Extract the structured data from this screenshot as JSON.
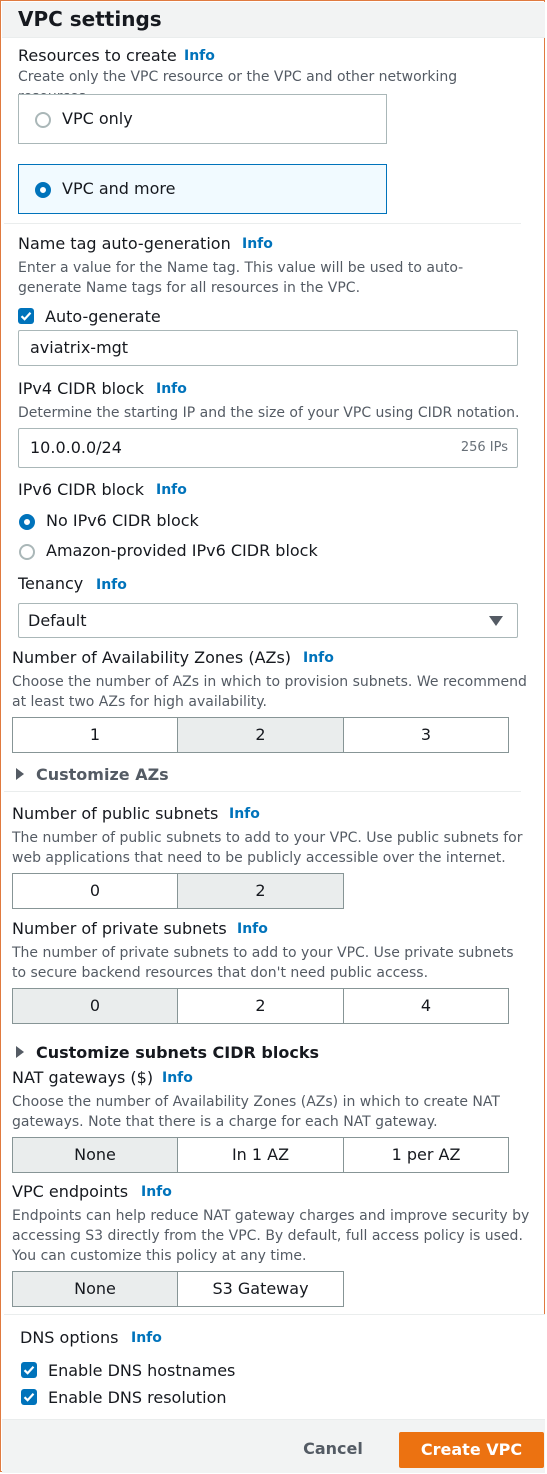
{
  "header": {
    "title": "VPC settings"
  },
  "resources": {
    "label": "Resources to create",
    "info": "Info",
    "description": "Create only the VPC resource or the VPC and other networking resources.",
    "options": [
      "VPC only",
      "VPC and more"
    ],
    "selected": "VPC and more"
  },
  "name_tag": {
    "label": "Name tag auto-generation",
    "info": "Info",
    "description": "Enter a value for the Name tag. This value will be used to auto-generate Name tags for all resources in the VPC.",
    "checkbox_label": "Auto-generate",
    "checked": true,
    "value": "aviatrix-mgt"
  },
  "ipv4": {
    "label": "IPv4 CIDR block",
    "info": "Info",
    "description": "Determine the starting IP and the size of your VPC using CIDR notation.",
    "value": "10.0.0.0/24",
    "suffix": "256 IPs"
  },
  "ipv6": {
    "label": "IPv6 CIDR block",
    "info": "Info",
    "options": [
      "No IPv6 CIDR block",
      "Amazon-provided IPv6 CIDR block"
    ],
    "selected": "No IPv6 CIDR block"
  },
  "tenancy": {
    "label": "Tenancy",
    "info": "Info",
    "value": "Default"
  },
  "azs": {
    "label": "Number of Availability Zones (AZs)",
    "info": "Info",
    "description": "Choose the number of AZs in which to provision subnets. We recommend at least two AZs for high availability.",
    "options": [
      "1",
      "2",
      "3"
    ],
    "selected": "2",
    "customize": "Customize AZs"
  },
  "public_subnets": {
    "label": "Number of public subnets",
    "info": "Info",
    "description": "The number of public subnets to add to your VPC. Use public subnets for web applications that need to be publicly accessible over the internet.",
    "options": [
      "0",
      "2"
    ],
    "selected": "2"
  },
  "private_subnets": {
    "label": "Number of private subnets",
    "info": "Info",
    "description": "The number of private subnets to add to your VPC. Use private subnets to secure backend resources that don't need public access.",
    "options": [
      "0",
      "2",
      "4"
    ],
    "selected": "0",
    "customize": "Customize subnets CIDR blocks"
  },
  "nat": {
    "label": "NAT gateways ($)",
    "info": "Info",
    "description": "Choose the number of Availability Zones (AZs) in which to create NAT gateways. Note that there is a charge for each NAT gateway.",
    "options": [
      "None",
      "In 1 AZ",
      "1 per AZ"
    ],
    "selected": "None"
  },
  "endpoints": {
    "label": "VPC endpoints",
    "info": "Info",
    "description": "Endpoints can help reduce NAT gateway charges and improve security by accessing S3 directly from the VPC. By default, full access policy is used. You can customize this policy at any time.",
    "options": [
      "None",
      "S3 Gateway"
    ],
    "selected": "None"
  },
  "dns": {
    "label": "DNS options",
    "info": "Info",
    "hostnames_label": "Enable DNS hostnames",
    "resolution_label": "Enable DNS resolution",
    "hostnames_checked": true,
    "resolution_checked": true
  },
  "footer": {
    "cancel_label": "Cancel",
    "create_label": "Create VPC"
  },
  "colors": {
    "link": "#0073bb",
    "primary": "#ec7211",
    "selected_tile_bg": "#f1faff",
    "selected_segment_bg": "#eaeded"
  },
  "icons": {
    "checkbox": "check-icon",
    "expand": "caret-right-icon",
    "dropdown": "caret-down-icon"
  }
}
